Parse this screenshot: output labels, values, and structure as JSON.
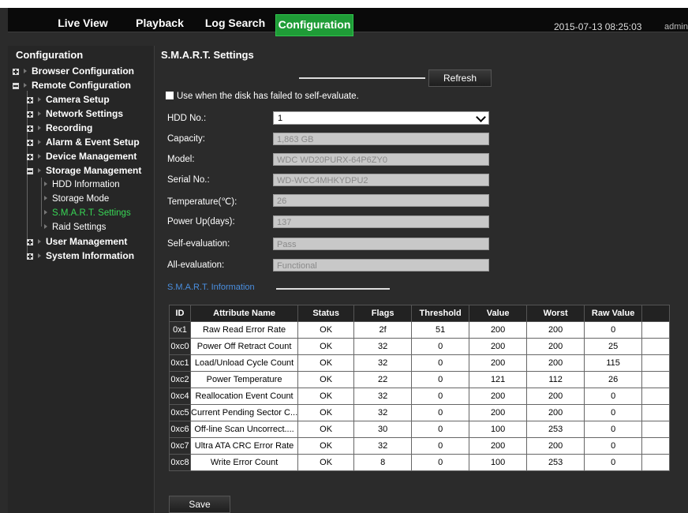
{
  "nav": {
    "tabs": [
      {
        "label": "Live View"
      },
      {
        "label": "Playback"
      },
      {
        "label": "Log Search"
      },
      {
        "label": "Configuration",
        "active": true
      }
    ],
    "datetime": "2015-07-13 08:25:03",
    "user": "admin"
  },
  "sidebar": {
    "title": "Configuration",
    "items": [
      {
        "label": "Browser Configuration"
      },
      {
        "label": "Remote Configuration"
      },
      {
        "label": "Camera Setup"
      },
      {
        "label": "Network Settings"
      },
      {
        "label": "Recording"
      },
      {
        "label": "Alarm & Event Setup"
      },
      {
        "label": "Device Management"
      },
      {
        "label": "Storage Management"
      },
      {
        "label": "HDD Information"
      },
      {
        "label": "Storage Mode"
      },
      {
        "label": "S.M.A.R.T. Settings",
        "selected": true
      },
      {
        "label": "Raid Settings"
      },
      {
        "label": "User Management"
      },
      {
        "label": "System Information"
      }
    ]
  },
  "main": {
    "title": "S.M.A.R.T. Settings",
    "refresh_label": "Refresh",
    "checkbox_label": "Use when the disk has failed to self-evaluate.",
    "fields": [
      {
        "label": "HDD No.:",
        "value": "1"
      },
      {
        "label": "Capacity:",
        "value": "1,863 GB"
      },
      {
        "label": "Model:",
        "value": "WDC WD20PURX-64P6ZY0"
      },
      {
        "label": "Serial No.:",
        "value": "WD-WCC4MHKYDPU2"
      },
      {
        "label": "Temperature(℃):",
        "value": "26"
      },
      {
        "label": "Power Up(days):",
        "value": "137"
      },
      {
        "label": "Self-evaluation:",
        "value": "Pass"
      },
      {
        "label": "All-evaluation:",
        "value": "Functional"
      }
    ],
    "section_title": "S.M.A.R.T. Information",
    "table": {
      "headers": [
        "ID",
        "Attribute Name",
        "Status",
        "Flags",
        "Threshold",
        "Value",
        "Worst",
        "Raw Value",
        ""
      ],
      "rows": [
        [
          "0x1",
          "Raw Read Error Rate",
          "OK",
          "2f",
          "51",
          "200",
          "200",
          "0",
          ""
        ],
        [
          "0xc0",
          "Power Off Retract Count",
          "OK",
          "32",
          "0",
          "200",
          "200",
          "25",
          ""
        ],
        [
          "0xc1",
          "Load/Unload Cycle Count",
          "OK",
          "32",
          "0",
          "200",
          "200",
          "115",
          ""
        ],
        [
          "0xc2",
          "Power Temperature",
          "OK",
          "22",
          "0",
          "121",
          "112",
          "26",
          ""
        ],
        [
          "0xc4",
          "Reallocation Event Count",
          "OK",
          "32",
          "0",
          "200",
          "200",
          "0",
          ""
        ],
        [
          "0xc5",
          "Current Pending Sector C...",
          "OK",
          "32",
          "0",
          "200",
          "200",
          "0",
          ""
        ],
        [
          "0xc6",
          "Off-line Scan Uncorrect....",
          "OK",
          "30",
          "0",
          "100",
          "253",
          "0",
          ""
        ],
        [
          "0xc7",
          "Ultra ATA CRC Error Rate",
          "OK",
          "32",
          "0",
          "200",
          "200",
          "0",
          ""
        ],
        [
          "0xc8",
          "Write Error Count",
          "OK",
          "8",
          "0",
          "100",
          "253",
          "0",
          ""
        ]
      ]
    },
    "save_label": "Save"
  }
}
